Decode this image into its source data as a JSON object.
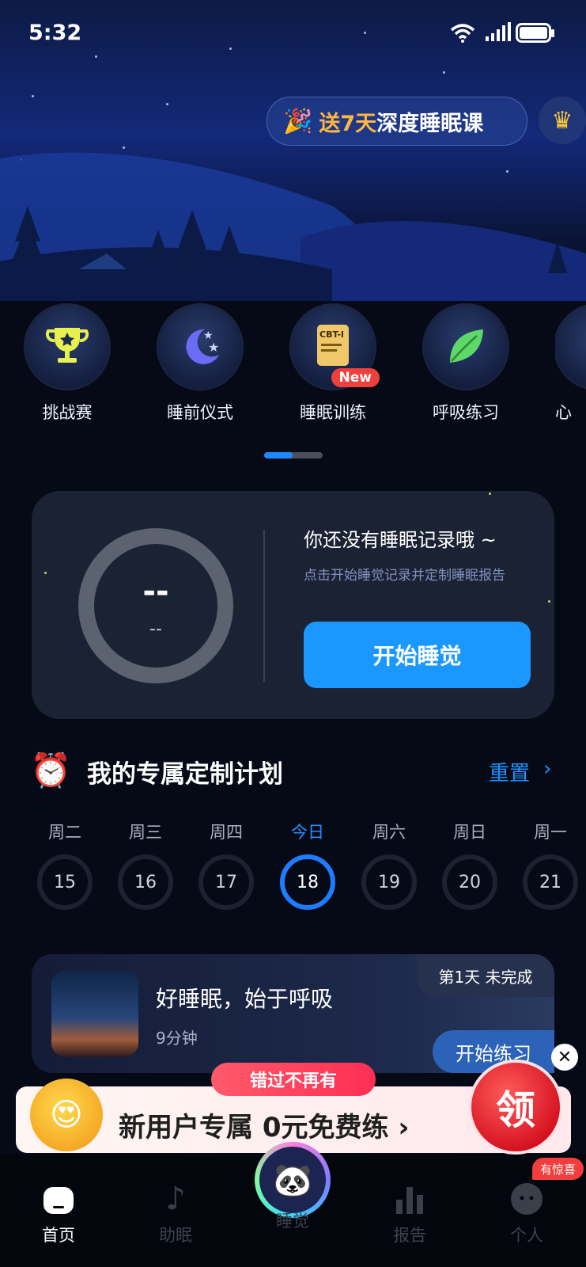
{
  "status_bar": {
    "time": "5:32"
  },
  "header": {
    "promo_prefix": "送7天",
    "promo_suffix": "深度睡眠课",
    "vip_icon": "crown-icon"
  },
  "features": [
    {
      "label": "挑战赛",
      "icon": "trophy-icon"
    },
    {
      "label": "睡前仪式",
      "icon": "moon-icon"
    },
    {
      "label": "睡眠训练",
      "icon": "cbt-document-icon",
      "badge": "New",
      "icon_text": "CBT-I"
    },
    {
      "label": "呼吸练习",
      "icon": "leaf-icon"
    },
    {
      "label": "心",
      "icon": "partial-icon"
    }
  ],
  "sleep_card": {
    "ring_value": "--",
    "ring_sub": "--",
    "no_record": "你还没有睡眠记录哦 ~",
    "hint": "点击开始睡觉记录并定制睡眠报告",
    "start_button": "开始睡觉"
  },
  "plan": {
    "title": "我的专属定制计划",
    "reset": "重置",
    "days": [
      {
        "weekday": "周二",
        "date": "15"
      },
      {
        "weekday": "周三",
        "date": "16"
      },
      {
        "weekday": "周四",
        "date": "17"
      },
      {
        "weekday": "今日",
        "date": "18",
        "today": true
      },
      {
        "weekday": "周六",
        "date": "19"
      },
      {
        "weekday": "周日",
        "date": "20"
      },
      {
        "weekday": "周一",
        "date": "21"
      }
    ]
  },
  "lesson": {
    "title": "好睡眠，始于呼吸",
    "duration": "9分钟",
    "badge": "第1天 未完成",
    "button": "开始练习"
  },
  "banner": {
    "tag": "错过不再有",
    "text": "新用户专属 0元免费练 ›",
    "grab": "领"
  },
  "tabbar": {
    "tabs": [
      {
        "label": "首页",
        "active": true
      },
      {
        "label": "助眠"
      },
      {
        "label": "睡觉"
      },
      {
        "label": "报告"
      },
      {
        "label": "个人"
      }
    ],
    "surprise": "有惊喜"
  },
  "colors": {
    "accent": "#1a98ff",
    "background": "#060a17",
    "badge_red": "#f0403d"
  }
}
